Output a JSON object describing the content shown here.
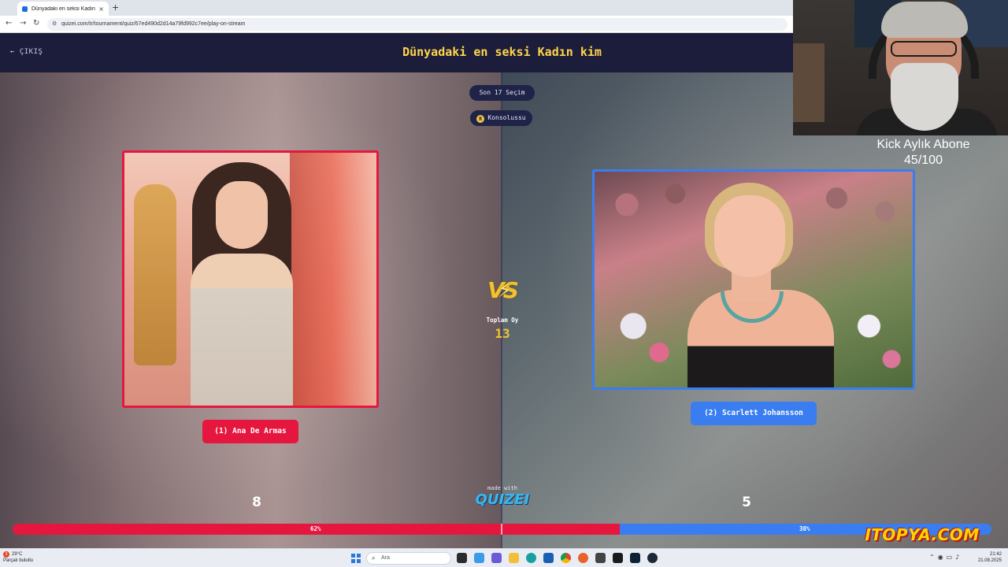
{
  "browser": {
    "tab_title": "Dünyadaki en seksi Kadın kim",
    "tab_close": "×",
    "new_tab": "+",
    "url": "quizei.com/tr/tournament/quiz/67ed490d2d14a79fd992c7ee/play-on-stream"
  },
  "header": {
    "exit_label": "← ÇIKIŞ",
    "title": "Dünyadaki en seksi Kadın kim"
  },
  "pills": {
    "round": "Son 17 Seçim",
    "channel_icon": "K",
    "channel": "Konsolussu"
  },
  "left": {
    "name": "(1) Ana De Armas",
    "votes": "8",
    "percent_label": "62%",
    "percent": 62
  },
  "right": {
    "name": "(2) Scarlett Johansson",
    "votes": "5",
    "percent_label": "38%",
    "percent": 38
  },
  "center": {
    "vs": "VS",
    "total_label": "Toplam Oy",
    "total_votes": "13",
    "made_with": "made with",
    "logo": "QUIZEI"
  },
  "overlay": {
    "sub_line1": "Kick Aylık Abone",
    "sub_line2": "45/100",
    "sponsor": "ITOPYA.COM"
  },
  "taskbar": {
    "weather_badge": "3",
    "temp": "29°C",
    "weather_text": "Parçalı bulutlu",
    "search_placeholder": "Ara",
    "time": "21:42",
    "date": "21.08.2025"
  },
  "colors": {
    "left_accent": "#e6173f",
    "right_accent": "#3a7df0",
    "title_yellow": "#ffd54a",
    "header_bg": "#1c1d3b"
  }
}
